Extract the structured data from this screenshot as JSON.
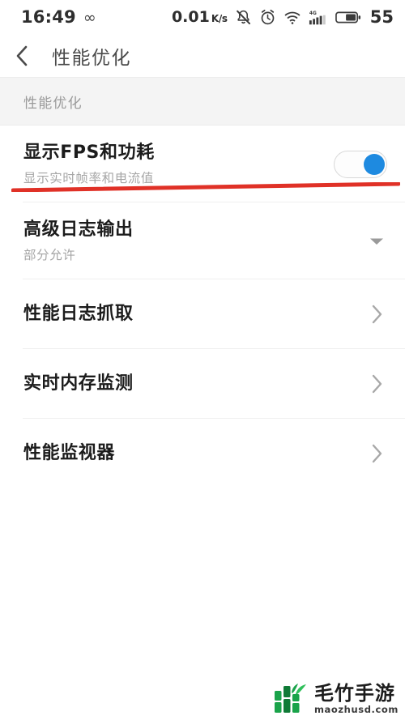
{
  "status_bar": {
    "time": "16:49",
    "infinity_icon": "infinity-icon",
    "network_speed": "0.01",
    "network_speed_unit": "K/s",
    "icons": [
      "mute-bell-icon",
      "alarm-clock-icon",
      "wifi-icon",
      "signal-4g-icon",
      "battery-icon"
    ],
    "signal_label": "4G",
    "battery_level": "55"
  },
  "title_bar": {
    "back_icon": "back-chevron-icon",
    "title": "性能优化"
  },
  "section": {
    "header": "性能优化"
  },
  "rows": [
    {
      "title": "显示FPS和功耗",
      "subtitle": "显示实时帧率和电流值",
      "control": "toggle",
      "toggle_on": true
    },
    {
      "title": "高级日志输出",
      "subtitle": "部分允许",
      "control": "caret-down"
    },
    {
      "title": "性能日志抓取",
      "subtitle": "",
      "control": "chevron-right"
    },
    {
      "title": "实时内存监测",
      "subtitle": "",
      "control": "chevron-right"
    },
    {
      "title": "性能监视器",
      "subtitle": "",
      "control": "chevron-right"
    }
  ],
  "annotation": {
    "type": "red-underline",
    "color": "#e03127"
  },
  "watermark": {
    "brand": "毛竹手游",
    "url": "maozhusd.com",
    "logo_color": "#16a34a"
  },
  "colors": {
    "accent_blue": "#1e8ae0",
    "annotation_red": "#e03127",
    "section_bg": "#f4f4f4",
    "title_text": "#4a4a4a",
    "row_title": "#1c1c1c",
    "row_sub": "#a6a6a6"
  }
}
